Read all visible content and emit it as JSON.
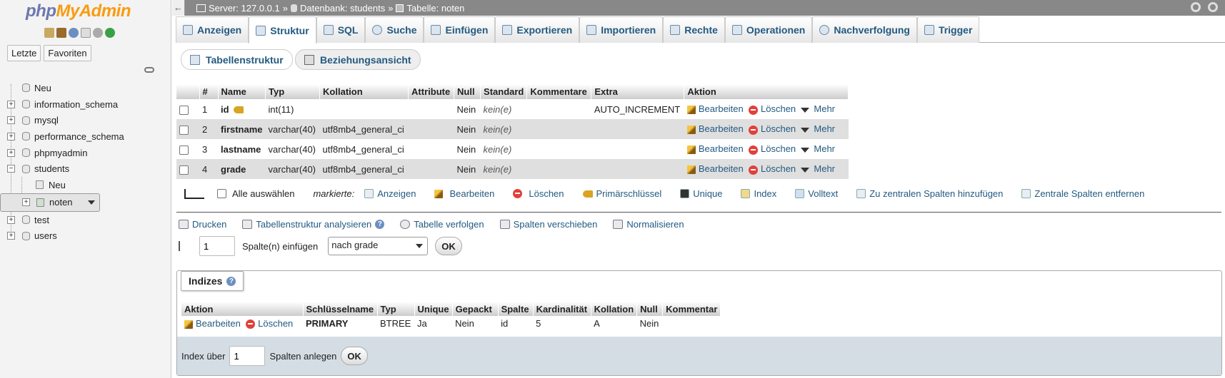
{
  "app": {
    "logo_php": "php",
    "logo_myadmin": "MyAdmin"
  },
  "nav": {
    "recent_label": "Letzte",
    "favorites_label": "Favoriten",
    "tree": [
      {
        "label": "Neu"
      },
      {
        "label": "information_schema"
      },
      {
        "label": "mysql"
      },
      {
        "label": "performance_schema"
      },
      {
        "label": "phpmyadmin"
      },
      {
        "label": "students"
      },
      {
        "label": "Neu"
      },
      {
        "label": "noten"
      },
      {
        "label": "test"
      },
      {
        "label": "users"
      }
    ]
  },
  "breadcrumb": {
    "server": "Server: 127.0.0.1",
    "sep1": "»",
    "database": "Datenbank: students",
    "sep2": "»",
    "table": "Tabelle: noten"
  },
  "tabs": [
    "Anzeigen",
    "Struktur",
    "SQL",
    "Suche",
    "Einfügen",
    "Exportieren",
    "Importieren",
    "Rechte",
    "Operationen",
    "Nachverfolgung",
    "Trigger"
  ],
  "active_tab": "Struktur",
  "subtabs": {
    "structure": "Tabellenstruktur",
    "relations": "Beziehungsansicht"
  },
  "structure": {
    "headers": [
      "#",
      "Name",
      "Typ",
      "Kollation",
      "Attribute",
      "Null",
      "Standard",
      "Kommentare",
      "Extra",
      "Aktion"
    ],
    "rows": [
      {
        "num": "1",
        "name": "id",
        "type": "int(11)",
        "collation": "",
        "attributes": "",
        "null": "Nein",
        "default": "kein(e)",
        "comment": "",
        "extra": "AUTO_INCREMENT"
      },
      {
        "num": "2",
        "name": "firstname",
        "type": "varchar(40)",
        "collation": "utf8mb4_general_ci",
        "attributes": "",
        "null": "Nein",
        "default": "kein(e)",
        "comment": "",
        "extra": ""
      },
      {
        "num": "3",
        "name": "lastname",
        "type": "varchar(40)",
        "collation": "utf8mb4_general_ci",
        "attributes": "",
        "null": "Nein",
        "default": "kein(e)",
        "comment": "",
        "extra": ""
      },
      {
        "num": "4",
        "name": "grade",
        "type": "varchar(40)",
        "collation": "utf8mb4_general_ci",
        "attributes": "",
        "null": "Nein",
        "default": "kein(e)",
        "comment": "",
        "extra": ""
      }
    ],
    "actions": {
      "edit": "Bearbeiten",
      "delete": "Löschen",
      "more": "Mehr"
    }
  },
  "bulk": {
    "select_all": "Alle auswählen",
    "marked": "markierte:",
    "actions": [
      "Anzeigen",
      "Bearbeiten",
      "Löschen",
      "Primärschlüssel",
      "Unique",
      "Index",
      "Volltext",
      "Zu zentralen Spalten hinzufügen",
      "Zentrale Spalten entfernen"
    ]
  },
  "tools": [
    "Drucken",
    "Tabellenstruktur analysieren",
    "Tabelle verfolgen",
    "Spalten verschieben",
    "Normalisieren"
  ],
  "insert": {
    "count": "1",
    "label": "Spalte(n) einfügen",
    "position": "nach grade",
    "ok": "OK"
  },
  "indexes": {
    "title": "Indizes",
    "headers": [
      "Aktion",
      "Schlüsselname",
      "Typ",
      "Unique",
      "Gepackt",
      "Spalte",
      "Kardinalität",
      "Kollation",
      "Null",
      "Kommentar"
    ],
    "rows": [
      {
        "edit": "Bearbeiten",
        "delete": "Löschen",
        "key": "PRIMARY",
        "type": "BTREE",
        "unique": "Ja",
        "packed": "Nein",
        "column": "id",
        "cardinality": "5",
        "collation": "A",
        "null": "Nein",
        "comment": ""
      }
    ],
    "footer": {
      "label_before": "Index über",
      "count": "1",
      "label_after": "Spalten anlegen",
      "ok": "OK"
    }
  }
}
